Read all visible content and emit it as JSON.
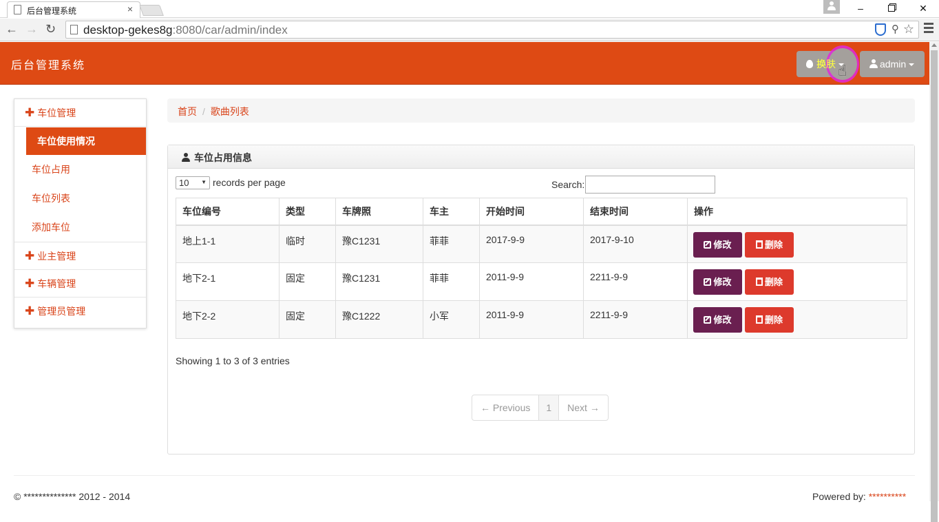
{
  "browser": {
    "tab_title": "后台管理系统",
    "tab_close": "×",
    "url_host": "desktop-gekes8g",
    "url_rest": ":8080/car/admin/index",
    "icons": [
      "document-icon",
      "back-icon",
      "forward-icon",
      "reload-icon",
      "shield-icon",
      "pin-icon",
      "star-icon",
      "menu-icon"
    ]
  },
  "window": {
    "minimize": "–",
    "close": "✕"
  },
  "header": {
    "brand": "后台管理系统",
    "skin_label": "换肤",
    "admin_label": "admin",
    "accent": "#de4a14"
  },
  "sidebar": {
    "groups": [
      {
        "label": "车位管理",
        "items": [
          "车位使用情况",
          "车位占用",
          "车位列表",
          "添加车位"
        ],
        "active": "车位使用情况"
      },
      {
        "label": "业主管理"
      },
      {
        "label": "车辆管理"
      },
      {
        "label": "管理员管理"
      }
    ]
  },
  "breadcrumb": {
    "home": "首页",
    "sep": "/",
    "current": "歌曲列表"
  },
  "panel": {
    "title": "车位占用信息",
    "length_value": "10",
    "length_label": "records per page",
    "search_label": "Search:",
    "search_value": "",
    "columns": [
      "车位编号",
      "类型",
      "车牌照",
      "车主",
      "开始时间",
      "结束时间",
      "操作"
    ],
    "rows": [
      [
        "地上1-1",
        "临时",
        "豫C1231",
        "菲菲",
        "2017-9-9",
        "2017-9-10"
      ],
      [
        "地下2-1",
        "固定",
        "豫C1231",
        "菲菲",
        "2011-9-9",
        "2211-9-9"
      ],
      [
        "地下2-2",
        "固定",
        "豫C1222",
        "小军",
        "2011-9-9",
        "2211-9-9"
      ]
    ],
    "edit_label": "修改",
    "delete_label": "删除",
    "info": "Showing 1 to 3 of 3 entries",
    "pager": {
      "previous": "← Previous",
      "page": "1",
      "next": "Next →"
    }
  },
  "footer": {
    "copyright": "© ************** 2012 - 2014",
    "powered_prefix": "Powered by: ",
    "powered_name": "**********"
  },
  "colors": {
    "edit": "#6a1f50",
    "delete": "#dd3a2c",
    "skin_text": "#ffff40"
  }
}
